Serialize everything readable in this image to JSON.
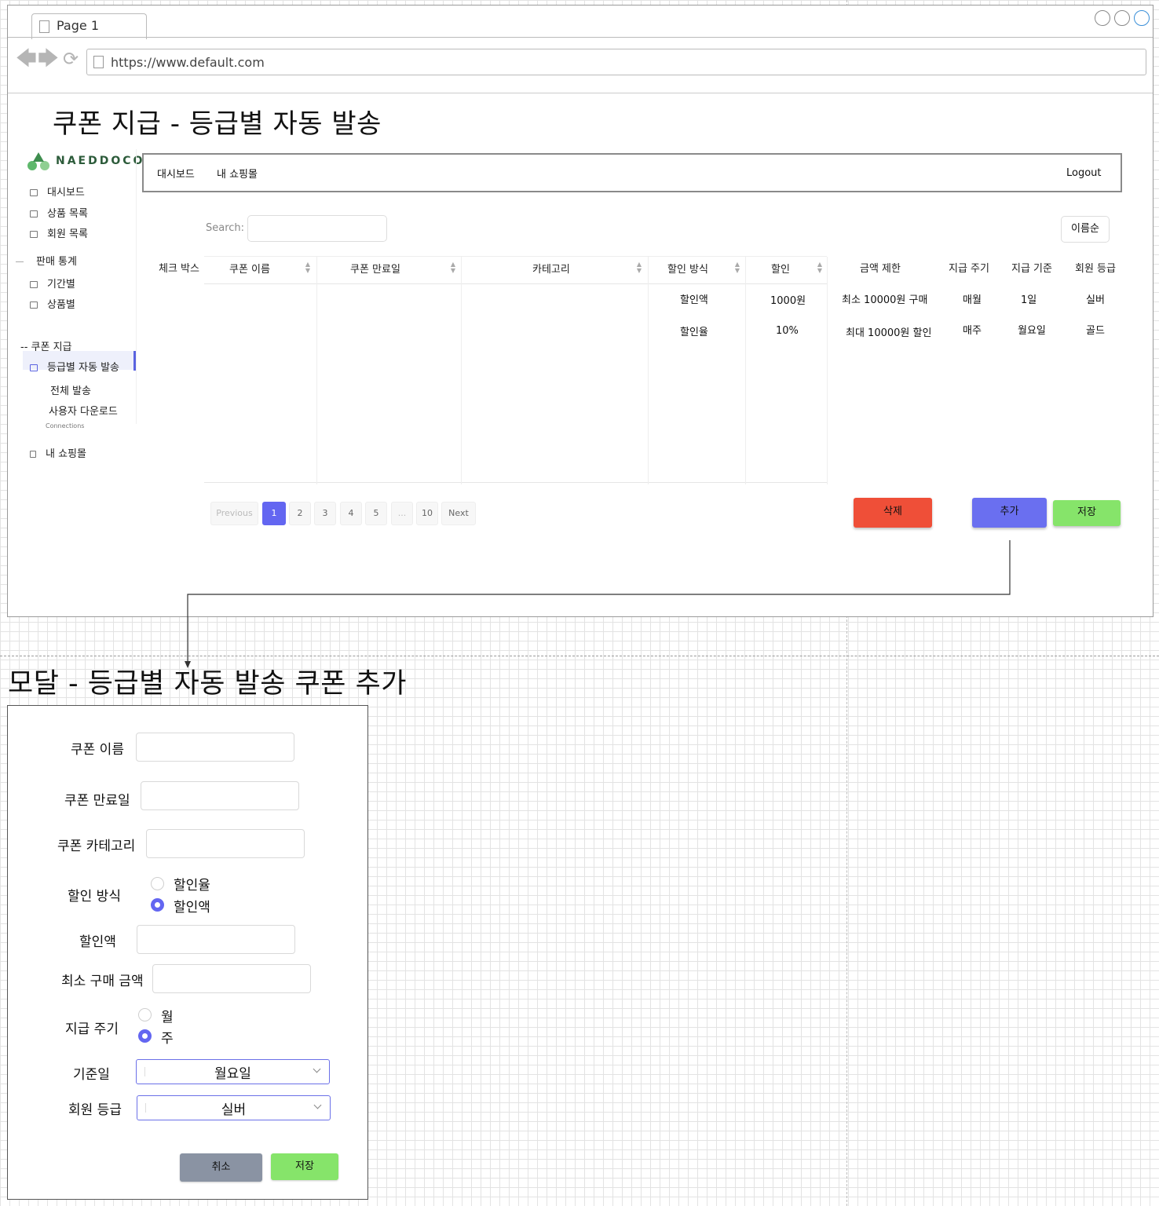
{
  "browser": {
    "tab_title": "Page 1",
    "url": "https://www.default.com"
  },
  "page": {
    "title": "쿠폰 지급 - 등급별 자동 발송"
  },
  "logo": {
    "brand": "NAEDDOCO"
  },
  "sidebar": {
    "items": [
      {
        "label": "대시보드",
        "icon": "home-icon"
      },
      {
        "label": "상품 목록",
        "icon": "grid-icon"
      },
      {
        "label": "회원 목록",
        "icon": "users-icon"
      }
    ],
    "stats_section": "판매 통계",
    "stats_items": [
      {
        "label": "기간별",
        "icon": "mail-icon"
      },
      {
        "label": "상품별",
        "icon": "box-icon"
      }
    ],
    "coupon_section": "-- 쿠폰 지급",
    "coupon_items": [
      {
        "label": "등급별 자동 발송",
        "active": true
      },
      {
        "label": "전체 발송"
      },
      {
        "label": "사용자 다운로드"
      }
    ],
    "connections": "Connections",
    "my_shop": "내 쇼핑몰"
  },
  "topnav": {
    "dashboard": "대시보드",
    "my_shop": "내 쇼핑몰",
    "logout": "Logout"
  },
  "search": {
    "label": "Search:",
    "value": ""
  },
  "sort_button": "이름순",
  "table": {
    "checkbox_header": "체크 박스",
    "headers": [
      "쿠폰 이름",
      "쿠폰 만료일",
      "카테고리",
      "할인 방식",
      "할인"
    ],
    "extra_headers": [
      "금액 제한",
      "지급 주기",
      "지급 기준",
      "회원 등급"
    ],
    "rows": [
      {
        "method": "할인액",
        "discount": "1000원",
        "limit": "최소 10000원 구매",
        "cycle": "매월",
        "basis": "1일",
        "grade": "실버"
      },
      {
        "method": "할인율",
        "discount": "10%",
        "limit": "최대 10000원 할인",
        "cycle": "매주",
        "basis": "월요일",
        "grade": "골드"
      }
    ]
  },
  "pagination": {
    "previous": "Previous",
    "pages": [
      "1",
      "2",
      "3",
      "4",
      "5",
      "...",
      "10"
    ],
    "current": "1",
    "next": "Next"
  },
  "actions": {
    "delete": "삭제",
    "add": "추가",
    "save": "저장"
  },
  "modal": {
    "title": "모달 - 등급별 자동 발송 쿠폰 추가",
    "coupon_name_label": "쿠폰 이름",
    "expiry_label": "쿠폰 만료일",
    "category_label": "쿠폰 카테고리",
    "discount_method_label": "할인 방식",
    "discount_options": [
      "할인율",
      "할인액"
    ],
    "discount_selected": "할인액",
    "amount_label": "할인액",
    "min_purchase_label": "최소 구매 금액",
    "cycle_label": "지급 주기",
    "cycle_options": [
      "월",
      "주"
    ],
    "cycle_selected": "주",
    "base_day_label": "기준일",
    "base_day_value": "월요일",
    "grade_label": "회원 등급",
    "grade_value": "실버",
    "cancel": "취소",
    "save": "저장"
  },
  "colors": {
    "accent": "#6366f1",
    "delete": "#ef4f38",
    "add": "#6a6ff0",
    "save": "#86e46a",
    "cancel": "#8a93a3"
  }
}
